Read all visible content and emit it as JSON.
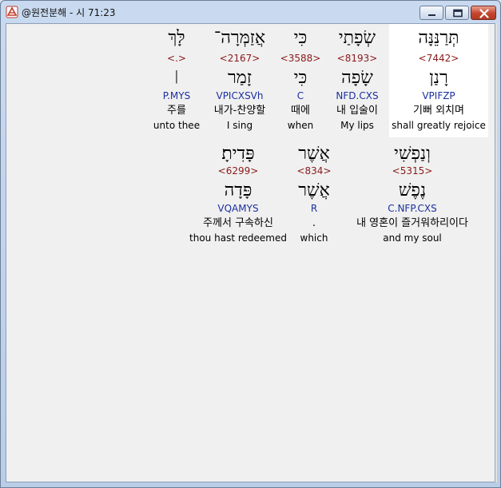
{
  "window": {
    "title": "@원전분해 - 시 71:23",
    "icon": "app-logo-icon",
    "controls": [
      "minimize-icon",
      "maximize-icon",
      "close-icon"
    ]
  },
  "lines": [
    [
      {
        "heb": "תְּרַנֵּנָּה",
        "strong": "<7442>",
        "root": "רָנַן",
        "morph": "VPIFZP",
        "kor": "기뻐 외치며",
        "eng": "shall greatly rejoice",
        "highlighted": true
      },
      {
        "heb": "שְׂפָתַי",
        "strong": "<8193>",
        "root": "שָׂפָה",
        "morph": "NFD.CXS",
        "kor": "내 입술이",
        "eng": "My lips"
      },
      {
        "heb": "כִּי",
        "strong": "<3588>",
        "root": "כִּי",
        "morph": "C",
        "kor": "때에",
        "eng": "when"
      },
      {
        "heb": "אֲזַמְּרָה־",
        "strong": "<2167>",
        "root": "זָמַר",
        "morph": "VPICXSVh",
        "kor": "내가-찬양할",
        "eng": "I sing"
      },
      {
        "heb": "לָּךְ",
        "strong": "<.>",
        "root": "׀",
        "morph": "P.MYS",
        "kor": "주를",
        "eng": "unto thee"
      }
    ],
    [
      {
        "heb": "וְנַפְשִׁי",
        "strong": "<5315>",
        "root": "נֶפֶשׁ",
        "morph": "C.NFP.CXS",
        "kor": "내 영혼이 즐거워하리이다",
        "eng": "and my soul"
      },
      {
        "heb": "אֲשֶׁר",
        "strong": "<834>",
        "root": "אֲשֶׁר",
        "morph": "R",
        "kor": ".",
        "eng": "which"
      },
      {
        "heb": "פָּדִיתָ׃",
        "strong": "<6299>",
        "root": "פָּדָה",
        "morph": "VQAMYS",
        "kor": "주께서 구속하신",
        "eng": "thou hast redeemed"
      }
    ]
  ]
}
